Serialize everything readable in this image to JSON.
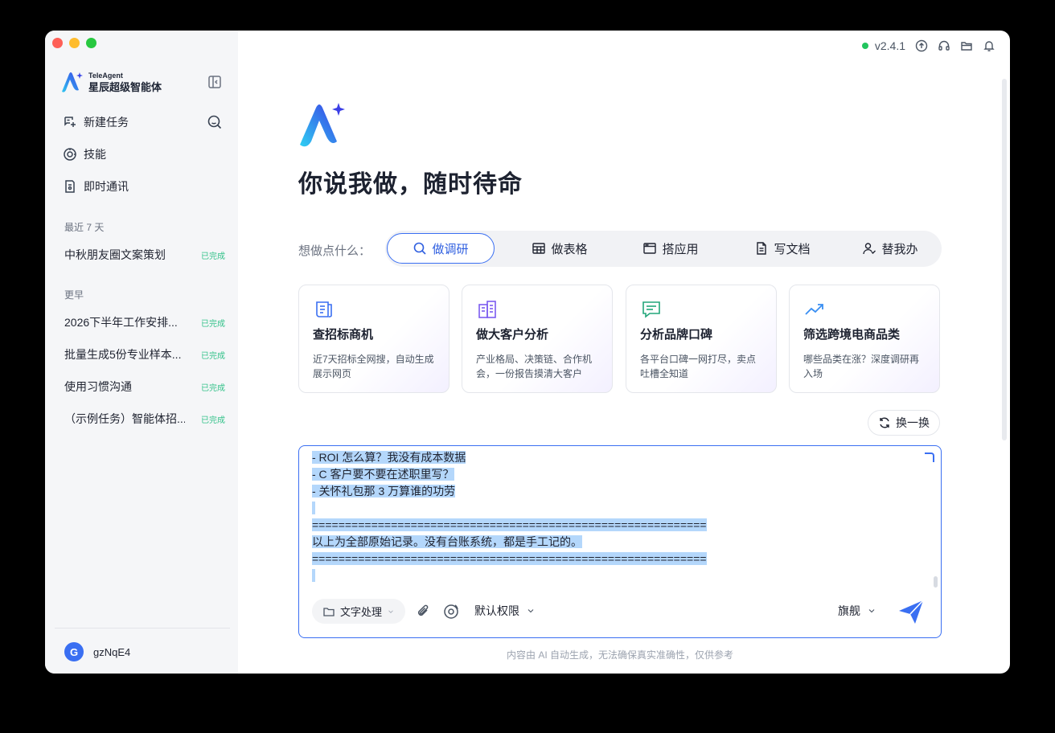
{
  "topbar": {
    "version": "v2.4.1"
  },
  "sidebar": {
    "brand_en": "TeleAgent",
    "brand_cn": "星辰超级智能体",
    "nav": [
      {
        "label": "新建任务",
        "icon": "new-task-icon"
      },
      {
        "label": "技能",
        "icon": "skill-icon"
      },
      {
        "label": "即时通讯",
        "icon": "chat-icon"
      }
    ],
    "recent_title": "最近 7 天",
    "recent": [
      {
        "title": "中秋朋友圈文案策划",
        "status": "已完成"
      }
    ],
    "earlier_title": "更早",
    "earlier": [
      {
        "title": "2026下半年工作安排...",
        "status": "已完成"
      },
      {
        "title": "批量生成5份专业样本...",
        "status": "已完成"
      },
      {
        "title": "使用习惯沟通",
        "status": "已完成"
      },
      {
        "title": "（示例任务）智能体招...",
        "status": "已完成"
      }
    ],
    "user": {
      "initial": "G",
      "name": "gzNqE4"
    }
  },
  "main": {
    "title": "你说我做，随时待命",
    "ask_label": "想做点什么：",
    "tabs": [
      {
        "label": "做调研",
        "icon": "search-icon",
        "active": true
      },
      {
        "label": "做表格",
        "icon": "table-icon",
        "active": false
      },
      {
        "label": "搭应用",
        "icon": "app-window-icon",
        "active": false
      },
      {
        "label": "写文档",
        "icon": "document-icon",
        "active": false
      },
      {
        "label": "替我办",
        "icon": "user-check-icon",
        "active": false
      }
    ],
    "cards": [
      {
        "title": "查招标商机",
        "desc": "近7天招标全网搜，自动生成展示网页",
        "icon": "bid-icon"
      },
      {
        "title": "做大客户分析",
        "desc": "产业格局、决策链、合作机会，一份报告摸清大客户",
        "icon": "building-icon"
      },
      {
        "title": "分析品牌口碑",
        "desc": "各平台口碑一网打尽，卖点吐槽全知道",
        "icon": "comment-icon"
      },
      {
        "title": "筛选跨境电商品类",
        "desc": "哪些品类在涨？深度调研再入场",
        "icon": "trend-icon"
      }
    ],
    "refresh_label": "换一换",
    "input": {
      "lines": [
        "- ROI 怎么算？我没有成本数据",
        "- C 客户要不要在述职里写？",
        "- 关怀礼包那 3 万算谁的功劳",
        " ",
        "============================================================",
        "以上为全部原始记录。没有台账系统，都是手工记的。",
        "============================================================",
        " "
      ]
    },
    "toolbar": {
      "mode_label": "文字处理",
      "permission_label": "默认权限",
      "model_label": "旗舰"
    },
    "disclaimer": "内容由 AI 自动生成，无法确保真实准确性，仅供参考"
  },
  "colors": {
    "accent": "#3a6ff2",
    "done": "#34c28a",
    "selection": "#b4d7fb"
  }
}
